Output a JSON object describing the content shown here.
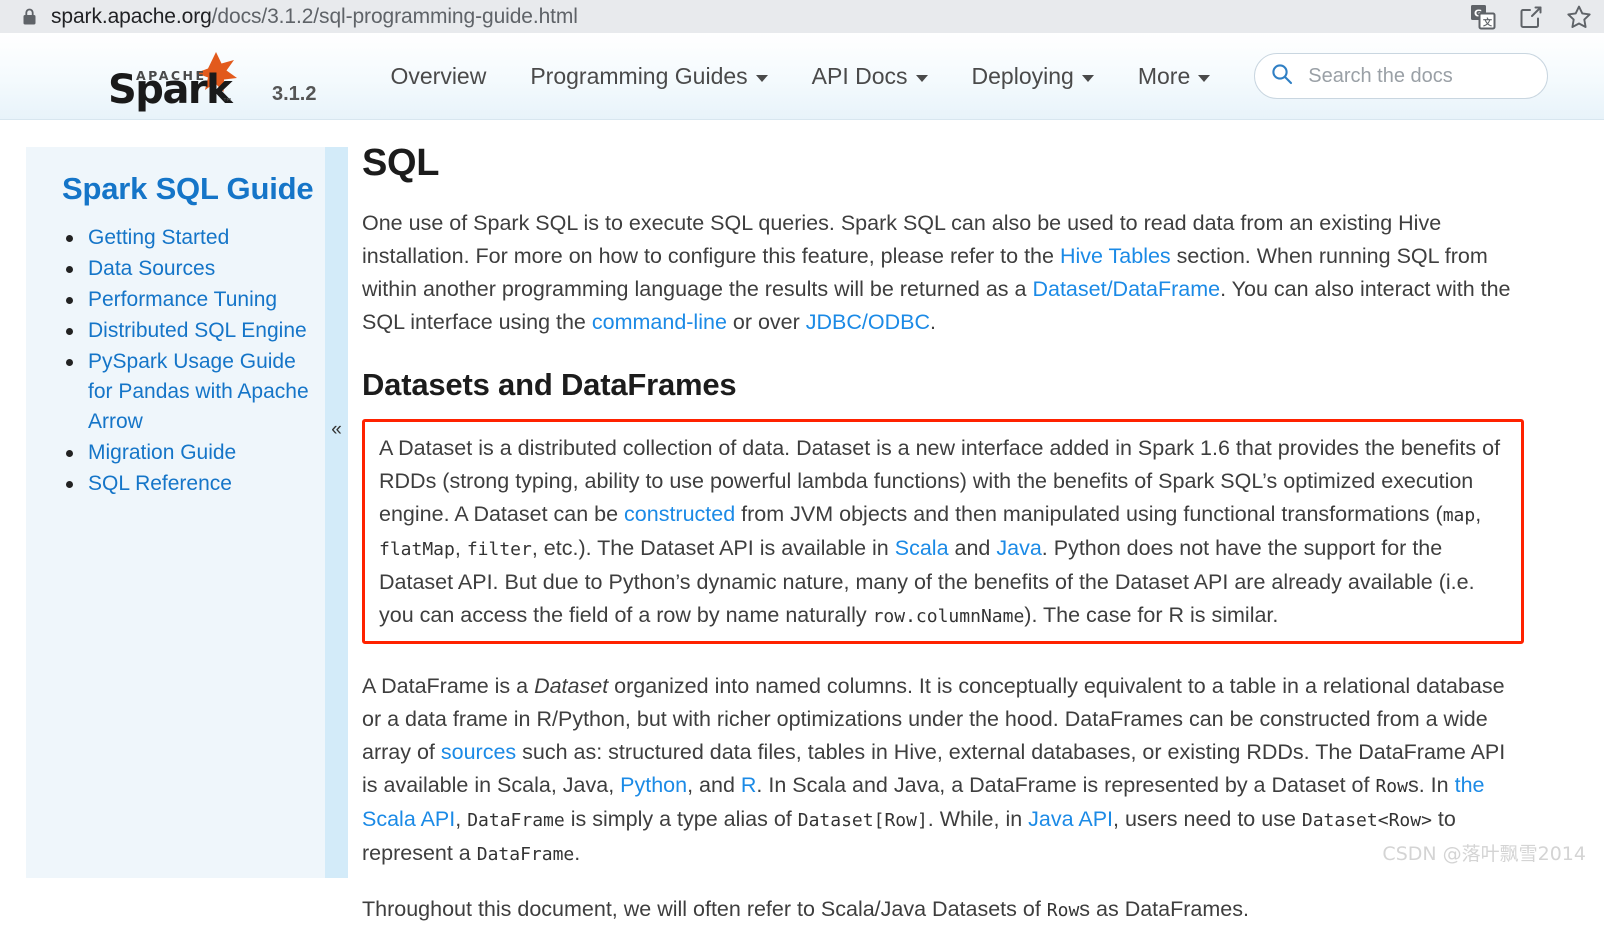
{
  "browser": {
    "url_host": "spark.apache.org",
    "url_path": "/docs/3.1.2/sql-programming-guide.html",
    "lock_icon": "lock-icon",
    "toolbar": [
      {
        "name": "translate-icon",
        "label": "Translate this page"
      },
      {
        "name": "share-icon",
        "label": "Share this page"
      },
      {
        "name": "bookmark-star-icon",
        "label": "Bookmark this tab"
      }
    ]
  },
  "navbar": {
    "logo_alt": "Apache Spark",
    "logo_apache": "APACHE",
    "logo_spark": "Spark",
    "logo_tm": "™",
    "version": "3.1.2",
    "links": [
      {
        "label": "Overview",
        "has_caret": false
      },
      {
        "label": "Programming Guides",
        "has_caret": true
      },
      {
        "label": "API Docs",
        "has_caret": true
      },
      {
        "label": "Deploying",
        "has_caret": true
      },
      {
        "label": "More",
        "has_caret": true
      }
    ],
    "search": {
      "placeholder": "Search the docs",
      "value": "",
      "icon": "search-icon"
    }
  },
  "sidebar": {
    "title": "Spark SQL Guide",
    "collapse_label": "«",
    "items": [
      {
        "label": "Getting Started"
      },
      {
        "label": "Data Sources"
      },
      {
        "label": "Performance Tuning"
      },
      {
        "label": "Distributed SQL Engine"
      },
      {
        "label": "PySpark Usage Guide for Pandas with Apache Arrow"
      },
      {
        "label": "Migration Guide"
      },
      {
        "label": "SQL Reference"
      }
    ]
  },
  "content": {
    "h1": "SQL",
    "p1": {
      "t1": "One use of Spark SQL is to execute SQL queries. Spark SQL can also be used to read data from an existing Hive installation. For more on how to configure this feature, please refer to the ",
      "link1": "Hive Tables",
      "t2": " section. When running SQL from within another programming language the results will be returned as a ",
      "link2": "Dataset/DataFrame",
      "t3": ". You can also interact with the SQL interface using the ",
      "link3": "command-line",
      "t4": " or over ",
      "link4": "JDBC/ODBC",
      "t5": "."
    },
    "h2": "Datasets and DataFrames",
    "callout": {
      "t1": "A Dataset is a distributed collection of data. Dataset is a new interface added in Spark 1.6 that provides the benefits of RDDs (strong typing, ability to use powerful lambda functions) with the benefits of Spark SQL’s optimized execution engine. A Dataset can be ",
      "link1": "constructed",
      "t2": " from JVM objects and then manipulated using functional transformations (",
      "code1": "map",
      "t3": ", ",
      "code2": "flatMap",
      "t4": ", ",
      "code3": "filter",
      "t5": ", etc.). The Dataset API is available in ",
      "link2": "Scala",
      "t6": " and ",
      "link3": "Java",
      "t7": ". Python does not have the support for the Dataset API. But due to Python’s dynamic nature, many of the benefits of the Dataset API are already available (i.e. you can access the field of a row by name naturally ",
      "code4": "row.columnName",
      "t8": "). The case for R is similar."
    },
    "p2": {
      "t1": "A DataFrame is a ",
      "em1": "Dataset",
      "t2": " organized into named columns. It is conceptually equivalent to a table in a relational database or a data frame in R/Python, but with richer optimizations under the hood. DataFrames can be constructed from a wide array of ",
      "link1": "sources",
      "t3": " such as: structured data files, tables in Hive, external databases, or existing RDDs. The DataFrame API is available in Scala, Java, ",
      "link2": "Python",
      "t4": ", and ",
      "link3": "R",
      "t5": ". In Scala and Java, a DataFrame is represented by a Dataset of ",
      "code1": "Row",
      "t6": "s. In ",
      "link4": "the Scala API",
      "t7": ", ",
      "code2": "DataFrame",
      "t8": " is simply a type alias of ",
      "code3": "Dataset[Row]",
      "t9": ". While, in ",
      "link5": "Java API",
      "t10": ", users need to use ",
      "code4": "Dataset<Row>",
      "t11": " to represent a ",
      "code5": "DataFrame",
      "t12": "."
    },
    "p3": {
      "t1": "Throughout this document, we will often refer to Scala/Java Datasets of ",
      "code1": "Row",
      "t2": "s as DataFrames."
    }
  },
  "watermark": "CSDN @落叶飘雪2014",
  "colors": {
    "link": "#1b8ae6",
    "sidebar_bg": "#eff6fb",
    "sidebar_strip": "#d3ebf9",
    "sidebar_title": "#1575c8",
    "callout_border": "#ff2200",
    "chrome_bg": "#e8eaed",
    "spark_orange": "#e25a1c"
  }
}
